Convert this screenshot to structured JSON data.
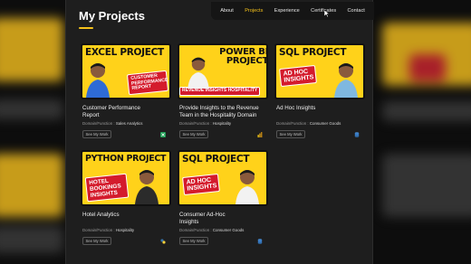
{
  "header": {
    "title": "My Projects"
  },
  "nav": {
    "items": [
      {
        "label": "About"
      },
      {
        "label": "Projects"
      },
      {
        "label": "Experience"
      },
      {
        "label": "Certificates"
      },
      {
        "label": "Contact"
      }
    ],
    "active": "Projects"
  },
  "colors": {
    "accent": "#f6c21b",
    "thumb_bg": "#ffd21a",
    "tag_red": "#d41b2c"
  },
  "projects": [
    {
      "thumb_title": "EXCEL PROJECT",
      "thumb_tag": "CUSTOMER PERFORMANCE REPORT",
      "name": "Customer Performance Report",
      "domain_label": "Domain/Function :",
      "domain": "Sales Analytics",
      "button": "See My Work",
      "tool_icon": "excel-icon"
    },
    {
      "thumb_title": "POWER BI PROJECT",
      "thumb_tag": "REVENUE INSIGHTS HOSPITALITY",
      "name": "Provide Insights to the Revenue Team in the Hospitality Domain",
      "domain_label": "Domain/Function :",
      "domain": "Hospitality",
      "button": "See My Work",
      "tool_icon": "power-bi-icon"
    },
    {
      "thumb_title": "SQL PROJECT",
      "thumb_tag": "AD HOC INSIGHTS",
      "name": "Ad Hoc Insights",
      "domain_label": "Domain/Function :",
      "domain": "Consumer Goods",
      "button": "See My Work",
      "tool_icon": "sql-icon"
    },
    {
      "thumb_title": "PYTHON PROJECT",
      "thumb_tag": "HOTEL BOOKINGS INSIGHTS",
      "name": "Hotel Analytics",
      "domain_label": "Domain/Function :",
      "domain": "Hospitality",
      "button": "See My Work",
      "tool_icon": "python-icon"
    },
    {
      "thumb_title": "SQL PROJECT",
      "thumb_tag": "AD HOC INSIGHTS",
      "name": "Consumer Ad-Hoc Insights",
      "domain_label": "Domain/Function :",
      "domain": "Consumer Goods",
      "button": "See My Work",
      "tool_icon": "sql-icon"
    }
  ]
}
